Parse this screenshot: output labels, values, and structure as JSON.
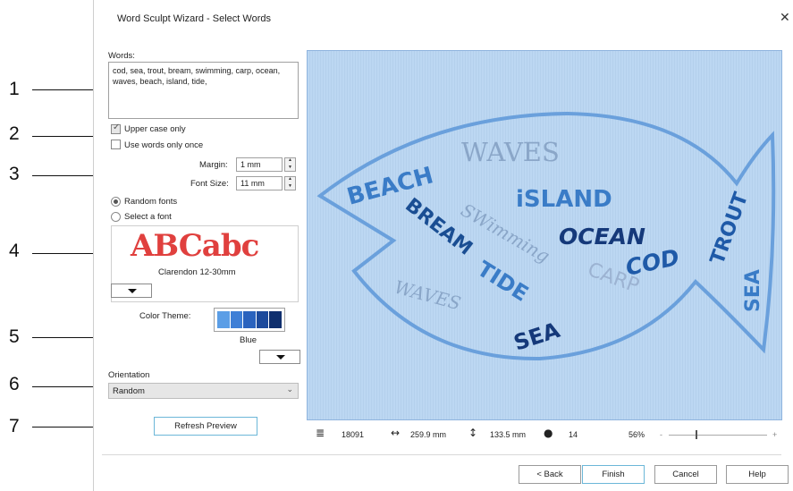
{
  "window": {
    "title": "Word Sculpt Wizard - Select Words",
    "close_glyph": "✕"
  },
  "callouts": [
    "1",
    "2",
    "3",
    "4",
    "5",
    "6",
    "7"
  ],
  "words": {
    "label": "Words:",
    "value": "cod, sea, trout, bream, swimming, carp, ocean, waves, beach, island, tide,"
  },
  "options": {
    "upper_case_label": "Upper case only",
    "upper_case_checked": true,
    "once_label": "Use words only once",
    "once_checked": false
  },
  "margin": {
    "label": "Margin:",
    "value": "1 mm"
  },
  "font_size": {
    "label": "Font Size:",
    "value": "11 mm"
  },
  "font_mode": {
    "random_label": "Random fonts",
    "select_label": "Select a font",
    "selected": "random"
  },
  "font_preview": {
    "sample": "ABCabc",
    "name": "Clarendon 12-30mm",
    "sample_color": "#e0403e"
  },
  "color_theme": {
    "label": "Color Theme:",
    "name": "Blue",
    "swatches": [
      "#5b9ee6",
      "#3f7fd6",
      "#2a63be",
      "#1c4a9c",
      "#0f2f6e"
    ]
  },
  "orientation": {
    "label": "Orientation",
    "value": "Random"
  },
  "refresh_label": "Refresh Preview",
  "preview": {
    "words": {
      "waves_top": "WAVES",
      "beach": "BEACH",
      "island": "iSLAND",
      "bream": "BREAM",
      "swimming": "SWimming",
      "ocean": "OCEAN",
      "cod": "COD",
      "trout": "TROUT",
      "carp": "CARP",
      "tide": "TIDE",
      "waves_bottom": "WAVES",
      "sea_bottom": "SEA",
      "sea_tail": "SEA"
    }
  },
  "status": {
    "stitches": "18091",
    "width": "259.9 mm",
    "height": "133.5 mm",
    "colors": "14",
    "zoom": "56%",
    "zoom_minus": "-",
    "zoom_plus": "+"
  },
  "buttons": {
    "back": "< Back",
    "finish": "Finish",
    "cancel": "Cancel",
    "help": "Help"
  }
}
